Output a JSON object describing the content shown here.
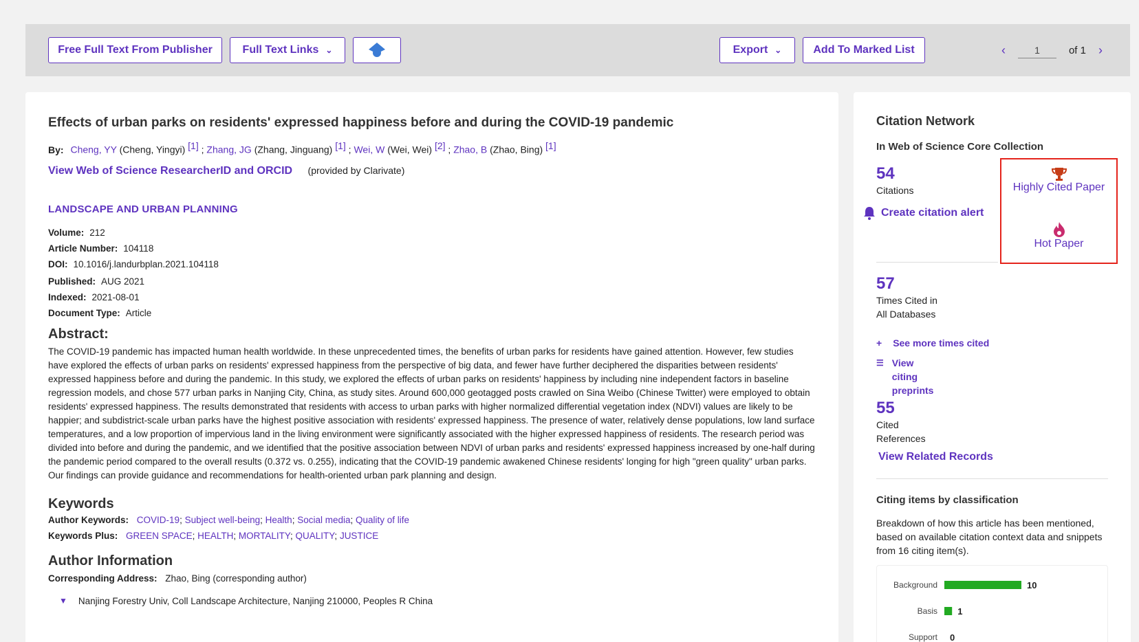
{
  "toolbar": {
    "free_full_text": "Free Full Text From Publisher",
    "full_text_links": "Full Text Links",
    "export": "Export",
    "add_marked": "Add To Marked List",
    "page": "1",
    "of": "of 1"
  },
  "record": {
    "title": "Effects of urban parks on residents' expressed happiness before and during the COVID-19 pandemic",
    "by_label": "By:",
    "authors": [
      {
        "abbr": "Cheng, YY",
        "full": "(Cheng, Yingyi)",
        "ref": "[1]"
      },
      {
        "abbr": "Zhang, JG",
        "full": "(Zhang, Jinguang)",
        "ref": "[1]"
      },
      {
        "abbr": "Wei, W",
        "full": "(Wei, Wei)",
        "ref": "[2]"
      },
      {
        "abbr": "Zhao, B",
        "full": "(Zhao, Bing)",
        "ref": "[1]"
      }
    ],
    "rid_link": "View Web of Science ResearcherID and ORCID",
    "rid_provided": "(provided by Clarivate)",
    "journal": "LANDSCAPE AND URBAN PLANNING",
    "volume_label": "Volume:",
    "volume": "212",
    "article_label": "Article Number:",
    "article": "104118",
    "doi_label": "DOI:",
    "doi": "10.1016/j.landurbplan.2021.104118",
    "published_label": "Published:",
    "published": "AUG 2021",
    "indexed_label": "Indexed:",
    "indexed": "2021-08-01",
    "doctype_label": "Document Type:",
    "doctype": "Article",
    "abstract_heading": "Abstract:",
    "abstract": "The COVID-19 pandemic has impacted human health worldwide. In these unprecedented times, the benefits of urban parks for residents have gained attention. However, few studies have explored the effects of urban parks on residents' expressed happiness from the perspective of big data, and fewer have further deciphered the disparities between residents' expressed happiness before and during the pandemic. In this study, we explored the effects of urban parks on residents' happiness by including nine independent factors in baseline regression models, and chose 577 urban parks in Nanjing City, China, as study sites. Around 600,000 geotagged posts crawled on Sina Weibo (Chinese Twitter) were employed to obtain residents' expressed happiness. The results demonstrated that residents with access to urban parks with higher normalized differential vegetation index (NDVI) values are likely to be happier; and subdistrict-scale urban parks have the highest positive association with residents' expressed happiness. The presence of water, relatively dense populations, low land surface temperatures, and a low proportion of impervious land in the living environment were significantly associated with the higher expressed happiness of residents. The research period was divided into before and during the pandemic, and we identified that the positive association between NDVI of urban parks and residents' expressed happiness increased by one-half during the pandemic period compared to the overall results (0.372 vs. 0.255), indicating that the COVID-19 pandemic awakened Chinese residents' longing for high \"green quality\" urban parks. Our findings can provide guidance and recommendations for health-oriented urban park planning and design.",
    "keywords_heading": "Keywords",
    "author_kw_label": "Author Keywords:",
    "author_keywords": [
      "COVID-19",
      "Subject well-being",
      "Health",
      "Social media",
      "Quality of life"
    ],
    "kw_plus_label": "Keywords Plus:",
    "keywords_plus": [
      "GREEN SPACE",
      "HEALTH",
      "MORTALITY",
      "QUALITY",
      "JUSTICE"
    ],
    "author_info_heading": "Author Information",
    "corr_label": "Corresponding Address:",
    "corr_name": "Zhao, Bing",
    "corr_role": "(corresponding author)",
    "corr_addr": "Nanjing Forestry Univ, Coll Landscape Architecture, Nanjing 210000, Peoples R China"
  },
  "side": {
    "heading": "Citation Network",
    "collection": "In Web of Science Core Collection",
    "citations": "54",
    "citations_label": "Citations",
    "alert": "Create citation alert",
    "highly_cited": "Highly Cited Paper",
    "hot_paper": "Hot Paper",
    "times_cited": "57",
    "times_cited_label_1": "Times Cited in",
    "times_cited_label_2": "All Databases",
    "see_more": "See more times cited",
    "view_preprints_1": "View",
    "view_preprints_2": "citing",
    "view_preprints_3": "preprints",
    "cited_refs": "55",
    "cited_refs_label_1": "Cited",
    "cited_refs_label_2": "References",
    "related": "View Related Records",
    "classification_heading": "Citing items by classification",
    "classification_desc": "Breakdown of how this article has been mentioned, based on available citation context data and snippets from 16 citing item(s).",
    "accent": "#5e33bf",
    "badge_border": "#e4231b",
    "bar_color": "#22aa22"
  },
  "chart_data": {
    "type": "bar",
    "orientation": "horizontal",
    "categories": [
      "Background",
      "Basis",
      "Support"
    ],
    "values": [
      10,
      1,
      0
    ]
  }
}
